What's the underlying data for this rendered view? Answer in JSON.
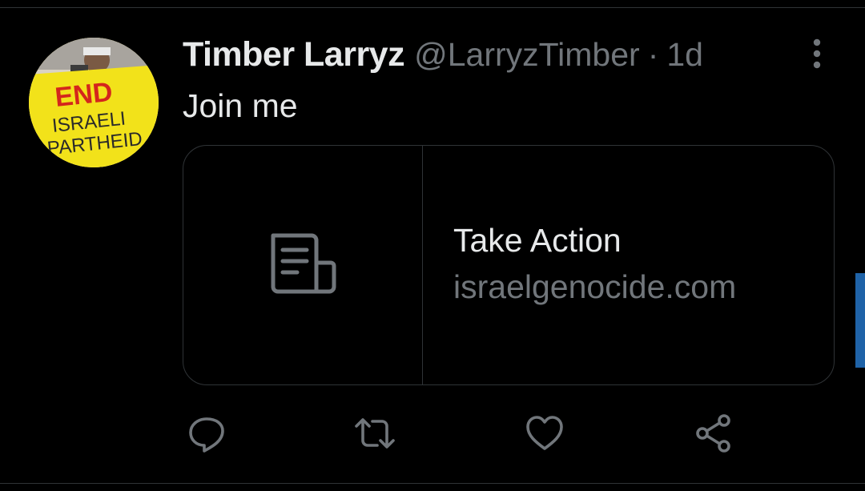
{
  "tweet": {
    "display_name": "Timber Larryz",
    "handle": "@LarryzTimber",
    "separator": "·",
    "time": "1d",
    "text": "Join me"
  },
  "avatar": {
    "sign_line1": "END",
    "sign_line2": "ISRAELI",
    "sign_line3": "APARTHEID"
  },
  "card": {
    "icon": "document-icon",
    "title": "Take Action",
    "domain": "israelgenocide.com"
  },
  "actions": [
    {
      "icon": "reply-icon"
    },
    {
      "icon": "retweet-icon"
    },
    {
      "icon": "like-icon"
    },
    {
      "icon": "share-icon"
    }
  ],
  "colors": {
    "background": "#000000",
    "primary_text": "#e7e9ea",
    "secondary_text": "#71767b",
    "border": "#2f3336",
    "accent": "#1f63a8"
  }
}
